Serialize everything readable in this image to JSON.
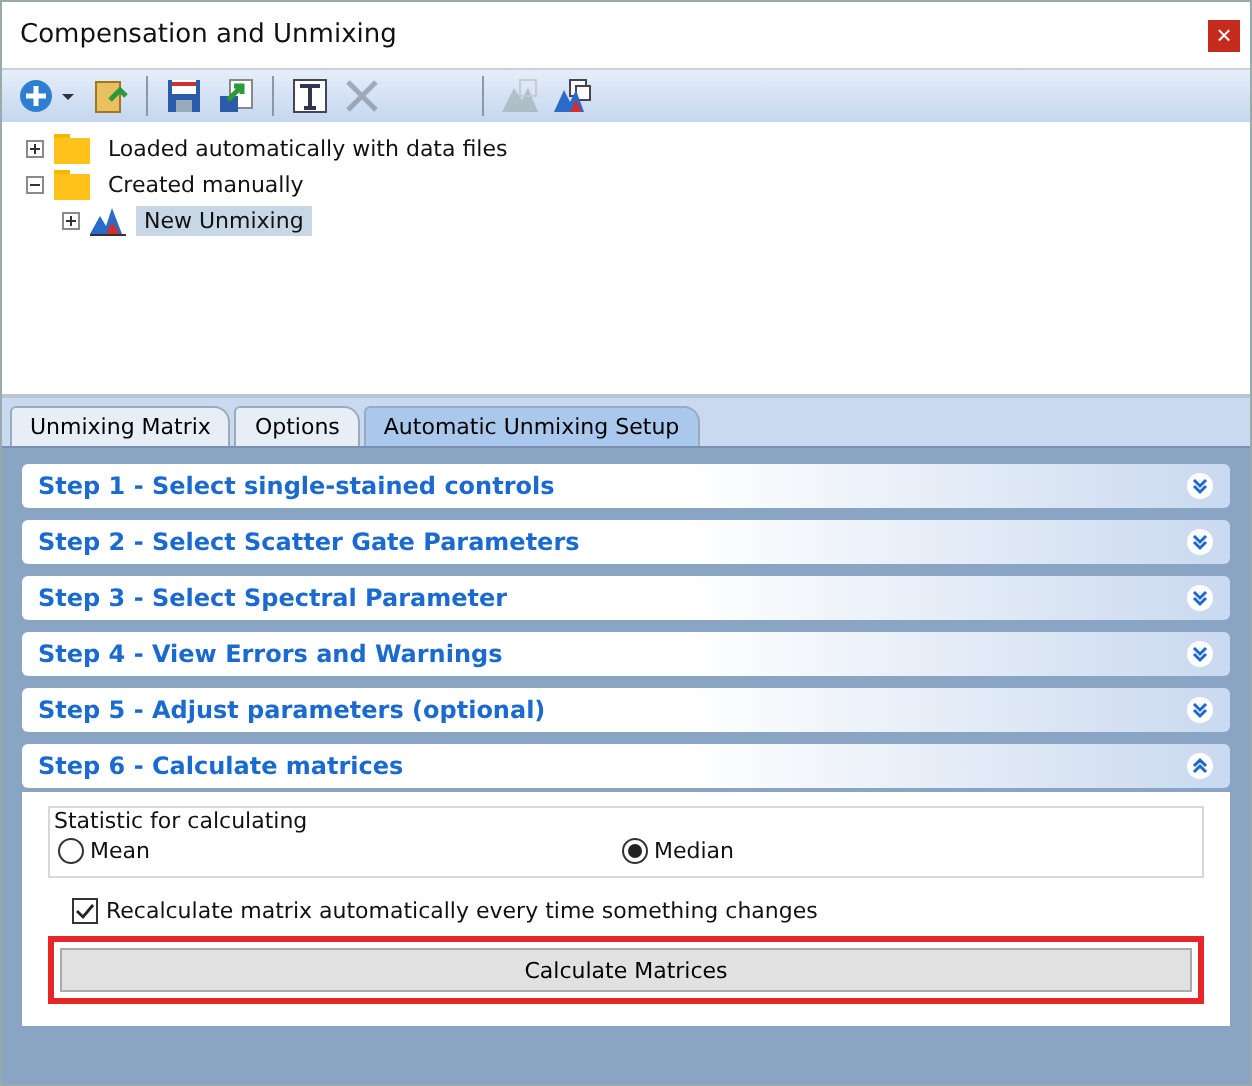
{
  "window": {
    "title": "Compensation and Unmixing",
    "close": "×"
  },
  "toolbar": [
    {
      "kind": "add",
      "disabled": false
    },
    {
      "kind": "open",
      "disabled": false
    },
    {
      "kind": "save",
      "disabled": false
    },
    {
      "kind": "export",
      "disabled": false
    },
    {
      "kind": "rename",
      "disabled": false
    },
    {
      "kind": "delete",
      "disabled": true
    },
    {
      "kind": "unmix",
      "disabled": true
    },
    {
      "kind": "copy",
      "disabled": false
    }
  ],
  "tree": [
    {
      "label": "Loaded automatically with data files",
      "kind": "folder",
      "expanded": false,
      "selected": false
    },
    {
      "label": "Created manually",
      "kind": "folder",
      "expanded": true,
      "selected": false,
      "children": [
        {
          "label": "New Unmixing",
          "kind": "unmixing",
          "expanded": false,
          "selected": true
        }
      ]
    }
  ],
  "tabs": [
    {
      "label": "Unmixing Matrix",
      "selected": false
    },
    {
      "label": "Options",
      "selected": false
    },
    {
      "label": "Automatic Unmixing Setup",
      "selected": true
    }
  ],
  "steps": [
    {
      "title": "Step 1 - Select single-stained controls",
      "expanded": false
    },
    {
      "title": "Step 2 - Select Scatter Gate Parameters",
      "expanded": false
    },
    {
      "title": "Step 3 - Select Spectral Parameter",
      "expanded": false
    },
    {
      "title": "Step 4 - View Errors and Warnings",
      "expanded": false
    },
    {
      "title": "Step 5 - Adjust parameters (optional)",
      "expanded": false
    },
    {
      "title": "Step 6 - Calculate matrices",
      "expanded": true
    }
  ],
  "calculate": {
    "group_title": "Statistic for calculating",
    "options": [
      {
        "label": "Mean",
        "selected": false
      },
      {
        "label": "Median",
        "selected": true
      }
    ],
    "auto_recalculate": {
      "label": "Recalculate matrix automatically every time something changes",
      "checked": true
    },
    "button": {
      "label": "Calculate Matrices",
      "highlighted": true
    }
  }
}
